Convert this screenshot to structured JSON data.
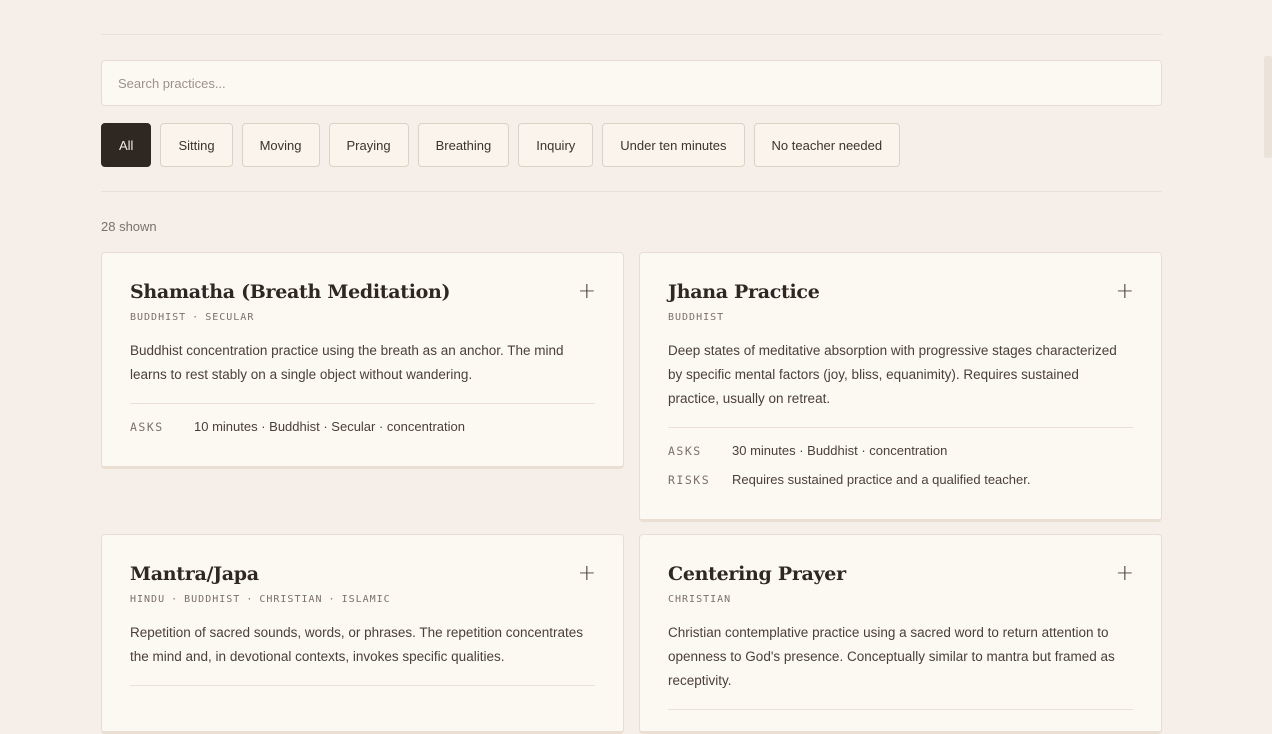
{
  "search": {
    "placeholder": "Search practices..."
  },
  "filters": [
    {
      "label": "All",
      "active": true
    },
    {
      "label": "Sitting",
      "active": false
    },
    {
      "label": "Moving",
      "active": false
    },
    {
      "label": "Praying",
      "active": false
    },
    {
      "label": "Breathing",
      "active": false
    },
    {
      "label": "Inquiry",
      "active": false
    },
    {
      "label": "Under ten minutes",
      "active": false
    },
    {
      "label": "No teacher needed",
      "active": false
    }
  ],
  "count_label": "28 shown",
  "cards": [
    {
      "title": "Shamatha (Breath Meditation)",
      "tags": [
        "BUDDHIST",
        "SECULAR"
      ],
      "description": "Buddhist concentration practice using the breath as an anchor. The mind learns to rest stably on a single object without wandering.",
      "asks_label": "ASKS",
      "asks": "10 minutes · Buddhist · Secular · concentration",
      "add_label": "+"
    },
    {
      "title": "Jhana Practice",
      "tags": [
        "BUDDHIST"
      ],
      "description": "Deep states of meditative absorption with progressive stages characterized by specific mental factors (joy, bliss, equanimity). Requires sustained practice, usually on retreat.",
      "asks_label": "ASKS",
      "asks": "30 minutes · Buddhist · concentration",
      "risks_label": "RISKS",
      "risks": "Requires sustained practice and a qualified teacher.",
      "add_label": "+"
    },
    {
      "title": "Mantra/Japa",
      "tags": [
        "HINDU",
        "BUDDHIST",
        "CHRISTIAN",
        "ISLAMIC"
      ],
      "description": "Repetition of sacred sounds, words, or phrases. The repetition concentrates the mind and, in devotional contexts, invokes specific qualities.",
      "add_label": "+"
    },
    {
      "title": "Centering Prayer",
      "tags": [
        "CHRISTIAN"
      ],
      "description": "Christian contemplative practice using a sacred word to return attention to openness to God's presence. Conceptually similar to mantra but framed as receptivity.",
      "add_label": "+"
    }
  ],
  "colors": {
    "background": "#f6efe9",
    "card": "#fcf8f2",
    "active_chip": "#2f2822",
    "text": "#3b332c",
    "muted": "#7b7168"
  }
}
